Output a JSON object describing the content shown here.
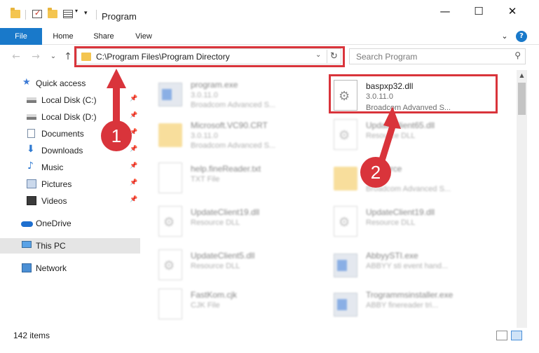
{
  "window": {
    "title": "Program",
    "controls": {
      "minimize": "—",
      "maximize": "☐",
      "close": "✕"
    }
  },
  "ribbon": {
    "tabs": [
      "File",
      "Home",
      "Share",
      "View"
    ],
    "expand_icon": "⌄",
    "help_icon": "?"
  },
  "nav": {
    "back_icon": "←",
    "forward_icon": "→",
    "recent_icon": "⌄",
    "up_icon": "↑",
    "address": "C:\\Program Files\\Program Directory",
    "address_dropdown": "⌄",
    "refresh_icon": "↻",
    "search_placeholder": "Search Program",
    "search_icon": "⚲"
  },
  "sidebar": {
    "items": [
      {
        "label": "Quick access",
        "icon": "star-icon",
        "pinned": false,
        "glyph": "★"
      },
      {
        "label": "Local Disk (C:)",
        "icon": "disk-icon",
        "pinned": true
      },
      {
        "label": "Local Disk (D:)",
        "icon": "disk-icon",
        "pinned": true
      },
      {
        "label": "Documents",
        "icon": "documents-icon",
        "pinned": true
      },
      {
        "label": "Downloads",
        "icon": "downloads-icon",
        "pinned": true,
        "glyph": "⬇"
      },
      {
        "label": "Music",
        "icon": "music-icon",
        "pinned": true,
        "glyph": "♪"
      },
      {
        "label": "Pictures",
        "icon": "pictures-icon",
        "pinned": true
      },
      {
        "label": "Videos",
        "icon": "videos-icon",
        "pinned": true
      },
      {
        "label": "OneDrive",
        "icon": "onedrive-icon",
        "pinned": false
      },
      {
        "label": "This PC",
        "icon": "this-pc-icon",
        "pinned": false,
        "selected": true
      },
      {
        "label": "Network",
        "icon": "network-icon",
        "pinned": false
      }
    ],
    "pin_glyph": "📌"
  },
  "files": {
    "left": [
      {
        "name": "program.exe",
        "line1": "3.0.11.0",
        "line2": "Broadcom Advanced S...",
        "icon": "exe-icon"
      },
      {
        "name": "Microsoft.VC90.CRT",
        "line1": "3.0.11.0",
        "line2": "Broadcom Advanced S...",
        "icon": "folder-icon"
      },
      {
        "name": "help.fineReader.txt",
        "line1": "TXT File",
        "line2": "",
        "icon": "text-file-icon"
      },
      {
        "name": "UpdateClient19.dll",
        "line1": "Resource DLL",
        "line2": "",
        "icon": "dll-icon"
      },
      {
        "name": "UpdateClient5.dll",
        "line1": "Resource DLL",
        "line2": "",
        "icon": "dll-icon"
      },
      {
        "name": "FastKom.cjk",
        "line1": "CJK File",
        "line2": "",
        "icon": "text-file-icon"
      }
    ],
    "right": [
      {
        "name": "baspxp32.dll",
        "line1": "3.0.11.0",
        "line2": "Broadcom Advanved S...",
        "icon": "dll-icon",
        "highlight": true
      },
      {
        "name": "UpdateClient65.dll",
        "line1": "Resource DLL",
        "line2": "",
        "icon": "dll-icon"
      },
      {
        "name": "Resource",
        "line1": "",
        "line2": "Broadcom Advanced S...",
        "icon": "folder-icon"
      },
      {
        "name": "UpdateClient19.dll",
        "line1": "Resource DLL",
        "line2": "",
        "icon": "dll-icon"
      },
      {
        "name": "AbbyySTI.exe",
        "line1": "ABBYY sti event hand...",
        "line2": "",
        "icon": "exe-icon"
      },
      {
        "name": "Trogrammsinstaller.exe",
        "line1": "ABBY finereader tri...",
        "line2": "",
        "icon": "exe-icon"
      }
    ]
  },
  "status": {
    "count": "142 items"
  },
  "annotations": {
    "marker1": "1",
    "marker2": "2",
    "color": "#d9343b"
  },
  "colors": {
    "accent": "#1979ca",
    "highlight": "#d9343b",
    "folder": "#f4c550"
  }
}
